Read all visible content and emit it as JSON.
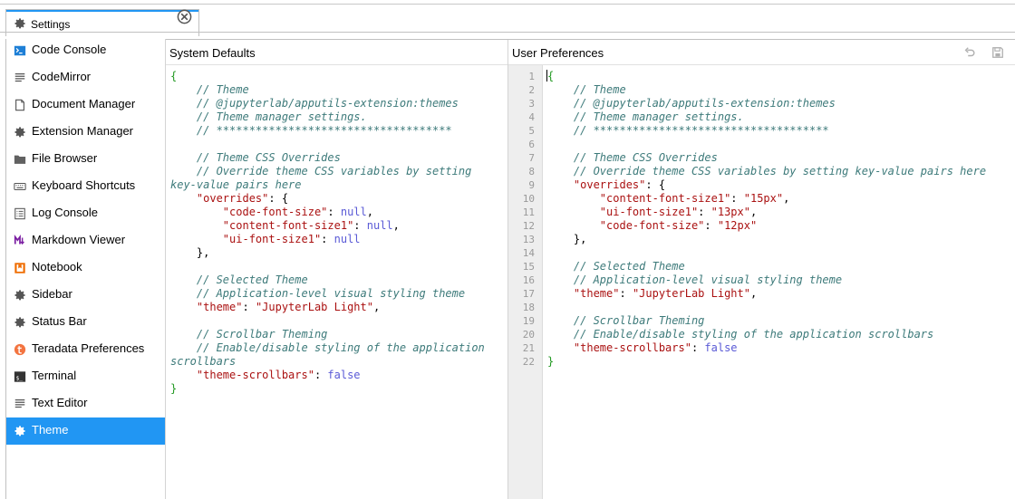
{
  "tab": {
    "label": "Settings",
    "icon": "gear-icon",
    "close_icon": "close-circle-icon"
  },
  "sidebar": {
    "items": [
      {
        "label": "Code Console",
        "icon": "console-icon"
      },
      {
        "label": "CodeMirror",
        "icon": "text-lines-icon"
      },
      {
        "label": "Document Manager",
        "icon": "document-icon"
      },
      {
        "label": "Extension Manager",
        "icon": "gear-icon"
      },
      {
        "label": "File Browser",
        "icon": "folder-icon"
      },
      {
        "label": "Keyboard Shortcuts",
        "icon": "keyboard-icon"
      },
      {
        "label": "Log Console",
        "icon": "list-icon"
      },
      {
        "label": "Markdown Viewer",
        "icon": "markdown-icon"
      },
      {
        "label": "Notebook",
        "icon": "notebook-icon"
      },
      {
        "label": "Sidebar",
        "icon": "gear-icon"
      },
      {
        "label": "Status Bar",
        "icon": "gear-icon"
      },
      {
        "label": "Teradata Preferences",
        "icon": "teradata-logo-icon"
      },
      {
        "label": "Terminal",
        "icon": "terminal-icon"
      },
      {
        "label": "Text Editor",
        "icon": "text-lines-icon"
      },
      {
        "label": "Theme",
        "icon": "gear-icon",
        "active": true
      }
    ],
    "accent_color": "#2196f3"
  },
  "system_defaults": {
    "title": "System Defaults",
    "lines": [
      [
        [
          "brace",
          "{"
        ]
      ],
      [
        [
          "comment",
          "    // Theme"
        ]
      ],
      [
        [
          "comment",
          "    // @jupyterlab/apputils-extension:themes"
        ]
      ],
      [
        [
          "comment",
          "    // Theme manager settings."
        ]
      ],
      [
        [
          "comment",
          "    // ************************************"
        ]
      ],
      [],
      [
        [
          "comment",
          "    // Theme CSS Overrides"
        ]
      ],
      [
        [
          "comment",
          "    // Override theme CSS variables by setting"
        ]
      ],
      [
        [
          "comment",
          "key-value pairs here"
        ]
      ],
      [
        [
          "punct",
          "    "
        ],
        [
          "key",
          "\"overrides\""
        ],
        [
          "punct",
          ": {"
        ]
      ],
      [
        [
          "punct",
          "        "
        ],
        [
          "key",
          "\"code-font-size\""
        ],
        [
          "punct",
          ": "
        ],
        [
          "kw",
          "null"
        ],
        [
          "punct",
          ","
        ]
      ],
      [
        [
          "punct",
          "        "
        ],
        [
          "key",
          "\"content-font-size1\""
        ],
        [
          "punct",
          ": "
        ],
        [
          "kw",
          "null"
        ],
        [
          "punct",
          ","
        ]
      ],
      [
        [
          "punct",
          "        "
        ],
        [
          "key",
          "\"ui-font-size1\""
        ],
        [
          "punct",
          ": "
        ],
        [
          "kw",
          "null"
        ]
      ],
      [
        [
          "punct",
          "    },"
        ]
      ],
      [],
      [
        [
          "comment",
          "    // Selected Theme"
        ]
      ],
      [
        [
          "comment",
          "    // Application-level visual styling theme"
        ]
      ],
      [
        [
          "punct",
          "    "
        ],
        [
          "key",
          "\"theme\""
        ],
        [
          "punct",
          ": "
        ],
        [
          "str",
          "\"JupyterLab Light\""
        ],
        [
          "punct",
          ","
        ]
      ],
      [],
      [
        [
          "comment",
          "    // Scrollbar Theming"
        ]
      ],
      [
        [
          "comment",
          "    // Enable/disable styling of the application"
        ]
      ],
      [
        [
          "comment",
          "scrollbars"
        ]
      ],
      [
        [
          "punct",
          "    "
        ],
        [
          "key",
          "\"theme-scrollbars\""
        ],
        [
          "punct",
          ": "
        ],
        [
          "kw",
          "false"
        ]
      ],
      [
        [
          "brace",
          "}"
        ]
      ]
    ]
  },
  "user_preferences": {
    "title": "User Preferences",
    "undo_icon": "undo-icon",
    "save_icon": "save-icon",
    "line_numbers": [
      "1",
      "2",
      "3",
      "4",
      "5",
      "6",
      "7",
      "8",
      "9",
      "10",
      "11",
      "12",
      "13",
      "14",
      "15",
      "16",
      "17",
      "18",
      "19",
      "20",
      "21",
      "22"
    ],
    "lines": [
      [
        [
          "cursor",
          ""
        ],
        [
          "brace",
          "{"
        ]
      ],
      [
        [
          "comment",
          "    // Theme"
        ]
      ],
      [
        [
          "comment",
          "    // @jupyterlab/apputils-extension:themes"
        ]
      ],
      [
        [
          "comment",
          "    // Theme manager settings."
        ]
      ],
      [
        [
          "comment",
          "    // ************************************"
        ]
      ],
      [],
      [
        [
          "comment",
          "    // Theme CSS Overrides"
        ]
      ],
      [
        [
          "comment",
          "    // Override theme CSS variables by setting key-value pairs here"
        ]
      ],
      [
        [
          "punct",
          "    "
        ],
        [
          "key",
          "\"overrides\""
        ],
        [
          "punct",
          ": {"
        ]
      ],
      [
        [
          "punct",
          "        "
        ],
        [
          "key",
          "\"content-font-size1\""
        ],
        [
          "punct",
          ": "
        ],
        [
          "str",
          "\"15px\""
        ],
        [
          "punct",
          ","
        ]
      ],
      [
        [
          "punct",
          "        "
        ],
        [
          "key",
          "\"ui-font-size1\""
        ],
        [
          "punct",
          ": "
        ],
        [
          "str",
          "\"13px\""
        ],
        [
          "punct",
          ","
        ]
      ],
      [
        [
          "punct",
          "        "
        ],
        [
          "key",
          "\"code-font-size\""
        ],
        [
          "punct",
          ": "
        ],
        [
          "str",
          "\"12px\""
        ]
      ],
      [
        [
          "punct",
          "    },"
        ]
      ],
      [],
      [
        [
          "comment",
          "    // Selected Theme"
        ]
      ],
      [
        [
          "comment",
          "    // Application-level visual styling theme"
        ]
      ],
      [
        [
          "punct",
          "    "
        ],
        [
          "key",
          "\"theme\""
        ],
        [
          "punct",
          ": "
        ],
        [
          "str",
          "\"JupyterLab Light\""
        ],
        [
          "punct",
          ","
        ]
      ],
      [],
      [
        [
          "comment",
          "    // Scrollbar Theming"
        ]
      ],
      [
        [
          "comment",
          "    // Enable/disable styling of the application scrollbars"
        ]
      ],
      [
        [
          "punct",
          "    "
        ],
        [
          "key",
          "\"theme-scrollbars\""
        ],
        [
          "punct",
          ": "
        ],
        [
          "kw",
          "false"
        ]
      ],
      [
        [
          "brace",
          "}"
        ]
      ]
    ]
  }
}
